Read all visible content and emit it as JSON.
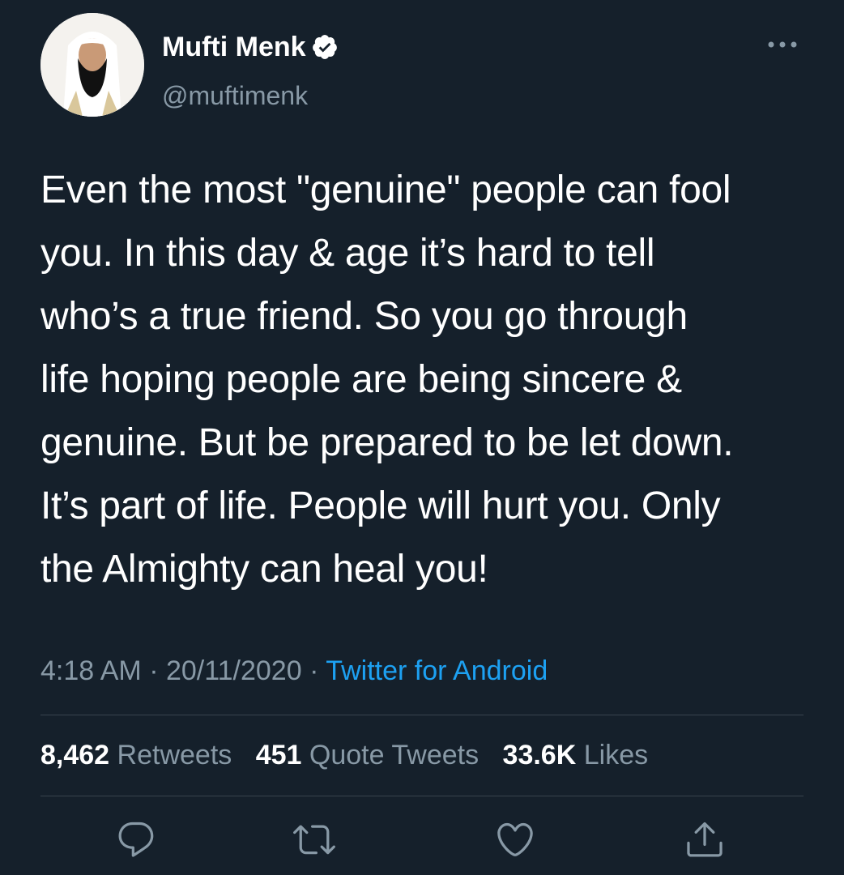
{
  "user": {
    "display_name": "Mufti Menk",
    "handle": "@muftimenk",
    "verified_icon": "verified-badge-icon"
  },
  "tweet": {
    "text": "Even the most \"genuine\" people can fool\nyou. In this day & age it’s hard to tell\nwho’s a true friend. So you go through\nlife hoping people are being sincere &\ngenuine. But be prepared to be let down.\nIt’s part of life. People will hurt you. Only\nthe Almighty can heal you!",
    "time": "4:18 AM",
    "separator": " · ",
    "date": "20/11/2020",
    "source": "Twitter for Android"
  },
  "stats": {
    "retweets_count": "8,462",
    "retweets_label": "Retweets",
    "quotes_count": "451",
    "quotes_label": "Quote Tweets",
    "likes_count": "33.6K",
    "likes_label": "Likes"
  },
  "actions": {
    "icons": [
      "reply-icon",
      "retweet-icon",
      "like-icon",
      "share-icon"
    ]
  },
  "colors": {
    "background": "#15202b",
    "text_primary": "#ffffff",
    "text_secondary": "#8899a6",
    "accent": "#1da1f2",
    "divider": "#38444d"
  }
}
